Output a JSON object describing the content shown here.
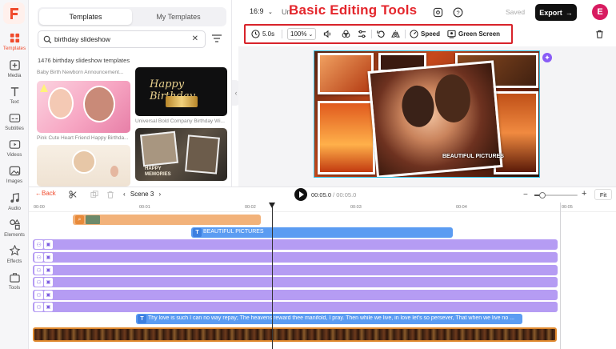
{
  "sidebar": {
    "items": [
      {
        "label": "Templates",
        "icon": "templates-icon"
      },
      {
        "label": "Media",
        "icon": "media-icon"
      },
      {
        "label": "Text",
        "icon": "text-icon"
      },
      {
        "label": "Subtitles",
        "icon": "subtitles-icon"
      },
      {
        "label": "Videos",
        "icon": "videos-icon"
      },
      {
        "label": "Images",
        "icon": "images-icon"
      },
      {
        "label": "Audio",
        "icon": "audio-icon"
      },
      {
        "label": "Elements",
        "icon": "elements-icon"
      },
      {
        "label": "Effects",
        "icon": "effects-icon"
      },
      {
        "label": "Tools",
        "icon": "tools-icon"
      }
    ],
    "accent": "#f04b2d"
  },
  "panel": {
    "tabs": [
      "Templates",
      "My Templates"
    ],
    "search_value": "birthday slideshow",
    "result_count": "1476 birthday slideshow templates",
    "templates": [
      {
        "caption": "Baby Birth Newborn Announcement..."
      },
      {
        "caption": "",
        "title": "Happy Birthday"
      },
      {
        "caption": "Pink Cute Heart Friend Happy Birthda..."
      },
      {
        "caption": "Universal Bold Company Birthday Wi..."
      },
      {
        "caption": "",
        "title": ""
      },
      {
        "caption": "",
        "title": "HAPPY MEMORIES"
      }
    ]
  },
  "topbar": {
    "ratio": "16:9",
    "project_prefix": "Un",
    "overlay_title": "Basic Editing Tools",
    "saved": "Saved",
    "export": "Export",
    "avatar_letter": "E"
  },
  "toolbar": {
    "duration": "5.0s",
    "zoom": "100%",
    "speed": "Speed",
    "green_screen": "Green Screen"
  },
  "canvas": {
    "caption": "BEAUTIFUL PICTURES"
  },
  "timeline": {
    "back": "Back",
    "scene": "Scene 3",
    "current_time": "00:05.0",
    "total_time": "00:05.0",
    "fit": "Fit",
    "ticks": [
      "00:00",
      "00:01",
      "00:02",
      "00:03",
      "00:04",
      "00:05"
    ],
    "text_clip": "BEAUTIFUL PICTURES",
    "subtitle_clip": "Thy love is such I can no way repay; The heavens reward thee manifold, I pray. Then while we live, in love let's so persever, That when we live no ..."
  }
}
